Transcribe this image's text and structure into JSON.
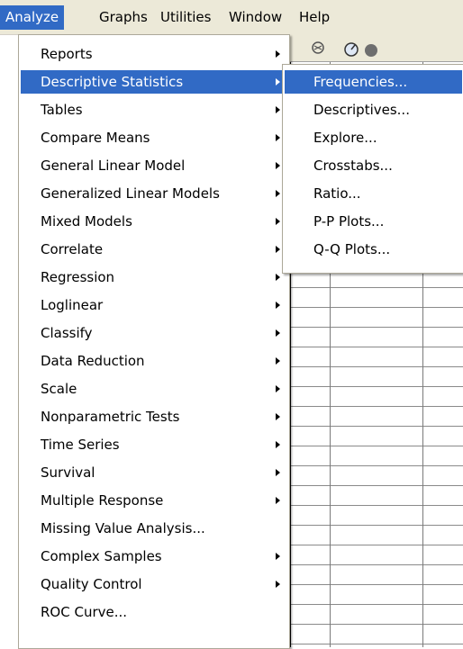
{
  "menubar": {
    "items": [
      {
        "label": "Analyze"
      },
      {
        "label": "Graphs"
      },
      {
        "label": "Utilities"
      },
      {
        "label": "Window"
      },
      {
        "label": "Help"
      }
    ]
  },
  "analyze_menu": {
    "items": [
      {
        "label": "Reports"
      },
      {
        "label": "Descriptive Statistics"
      },
      {
        "label": "Tables"
      },
      {
        "label": "Compare Means"
      },
      {
        "label": "General Linear Model"
      },
      {
        "label": "Generalized Linear Models"
      },
      {
        "label": "Mixed Models"
      },
      {
        "label": "Correlate"
      },
      {
        "label": "Regression"
      },
      {
        "label": "Loglinear"
      },
      {
        "label": "Classify"
      },
      {
        "label": "Data Reduction"
      },
      {
        "label": "Scale"
      },
      {
        "label": "Nonparametric Tests"
      },
      {
        "label": "Time Series"
      },
      {
        "label": "Survival"
      },
      {
        "label": "Multiple Response"
      },
      {
        "label": "Missing Value Analysis..."
      },
      {
        "label": "Complex Samples"
      },
      {
        "label": "Quality Control"
      },
      {
        "label": "ROC Curve..."
      }
    ]
  },
  "descriptive_submenu": {
    "items": [
      {
        "label": "Frequencies..."
      },
      {
        "label": "Descriptives..."
      },
      {
        "label": "Explore..."
      },
      {
        "label": "Crosstabs..."
      },
      {
        "label": "Ratio..."
      },
      {
        "label": "P-P Plots..."
      },
      {
        "label": "Q-Q Plots..."
      }
    ]
  },
  "colors": {
    "highlight": "#316AC5",
    "menubar_bg": "#ECE9D8",
    "menu_bg": "#FFFFFF"
  }
}
